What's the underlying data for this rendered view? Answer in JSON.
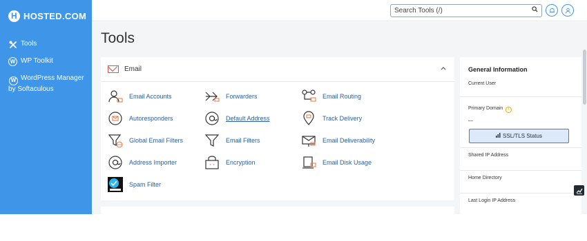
{
  "brand": {
    "name": "HOSTED.COM"
  },
  "sidebar": {
    "items": [
      {
        "label": "Tools",
        "icon": "tools-icon"
      },
      {
        "label": "WP Toolkit",
        "icon": "wordpress-icon"
      },
      {
        "label": "WordPress Manager by Softaculous",
        "icon": "wordpress-icon"
      }
    ]
  },
  "topbar": {
    "search_placeholder": "Search Tools (/)",
    "icons": [
      "search-icon",
      "notifications-icon",
      "user-icon"
    ]
  },
  "main": {
    "title": "Tools",
    "email_section": {
      "title": "Email",
      "tools": [
        {
          "label": "Email Accounts",
          "icon": "email-accounts-icon"
        },
        {
          "label": "Forwarders",
          "icon": "forwarders-icon"
        },
        {
          "label": "Email Routing",
          "icon": "email-routing-icon"
        },
        {
          "label": "Autoresponders",
          "icon": "autoresponders-icon"
        },
        {
          "label": "Default Address",
          "icon": "default-address-icon"
        },
        {
          "label": "Track Delivery",
          "icon": "track-delivery-icon"
        },
        {
          "label": "Global Email Filters",
          "icon": "global-email-filters-icon"
        },
        {
          "label": "Email Filters",
          "icon": "email-filters-icon"
        },
        {
          "label": "Email Deliverability",
          "icon": "email-deliverability-icon"
        },
        {
          "label": "Address Importer",
          "icon": "address-importer-icon"
        },
        {
          "label": "Encryption",
          "icon": "encryption-icon"
        },
        {
          "label": "Email Disk Usage",
          "icon": "email-disk-usage-icon"
        },
        {
          "label": "Spam Filter",
          "icon": "spam-filter-icon"
        }
      ]
    }
  },
  "general_info": {
    "title": "General Information",
    "current_user_label": "Current User",
    "primary_domain_label": "Primary Domain",
    "primary_domain_value": "—",
    "ssl_button": "SSL/TLS Status",
    "shared_ip_label": "Shared IP Address",
    "home_directory_label": "Home Directory",
    "last_login_label": "Last Login IP Address"
  },
  "colors": {
    "sidebar": "#3f96e8",
    "link": "#2a5d9f",
    "accent_red": "#d9534f"
  }
}
